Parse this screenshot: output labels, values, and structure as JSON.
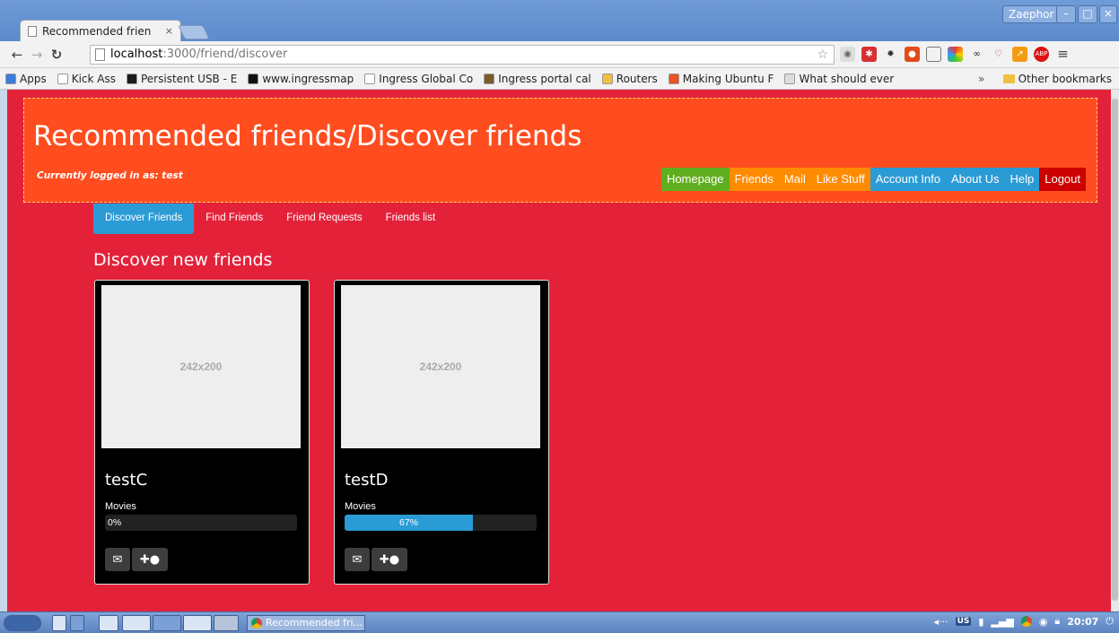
{
  "browser": {
    "tab_title": "Recommended frien",
    "tab_close": "×",
    "window_user": "Zaephor",
    "win_min": "–",
    "win_max": "□",
    "win_close": "×",
    "url_host": "localhost",
    "url_path": ":3000/friend/discover",
    "bookmarks": [
      {
        "label": "Apps",
        "color": "#3b7dd8"
      },
      {
        "label": "Kick Ass",
        "color": "#ffffff"
      },
      {
        "label": "Persistent USB - E",
        "color": "#1a1a1a"
      },
      {
        "label": "www.ingressmap",
        "color": "#111111"
      },
      {
        "label": "Ingress Global Co",
        "color": "#ffffff"
      },
      {
        "label": "Ingress portal cal",
        "color": "#7a5b2a"
      },
      {
        "label": "Routers",
        "color": "#f0c040"
      },
      {
        "label": "Making Ubuntu F",
        "color": "#e95420"
      },
      {
        "label": "What should ever",
        "color": "#dddddd"
      }
    ],
    "bookmarks_more": "»",
    "other_bookmarks": "Other bookmarks"
  },
  "page": {
    "title": "Recommended friends/Discover friends",
    "logged_in": "Currently logged in as: test",
    "main_nav": [
      {
        "label": "Homepage",
        "color": "#5fae1f"
      },
      {
        "label": "Friends",
        "color": "#ff8b00"
      },
      {
        "label": "Mail",
        "color": "#ff8b00"
      },
      {
        "label": "Like Stuff",
        "color": "#ff8b00"
      },
      {
        "label": "Account Info",
        "color": "#2b9bd6"
      },
      {
        "label": "About Us",
        "color": "#2b9bd6"
      },
      {
        "label": "Help",
        "color": "#2b9bd6"
      },
      {
        "label": "Logout",
        "color": "#cc0000"
      }
    ],
    "sub_nav": [
      "Discover Friends",
      "Find Friends",
      "Friend Requests",
      "Friends list"
    ],
    "section_title": "Discover new friends",
    "cards": [
      {
        "image_label": "242x200",
        "name": "testC",
        "interest": "Movies",
        "percent": 0,
        "percent_label": "0%"
      },
      {
        "image_label": "242x200",
        "name": "testD",
        "interest": "Movies",
        "percent": 67,
        "percent_label": "67%"
      }
    ]
  },
  "taskbar": {
    "task_label": "Recommended fri...",
    "keyboard": "US",
    "clock": "20:07"
  }
}
